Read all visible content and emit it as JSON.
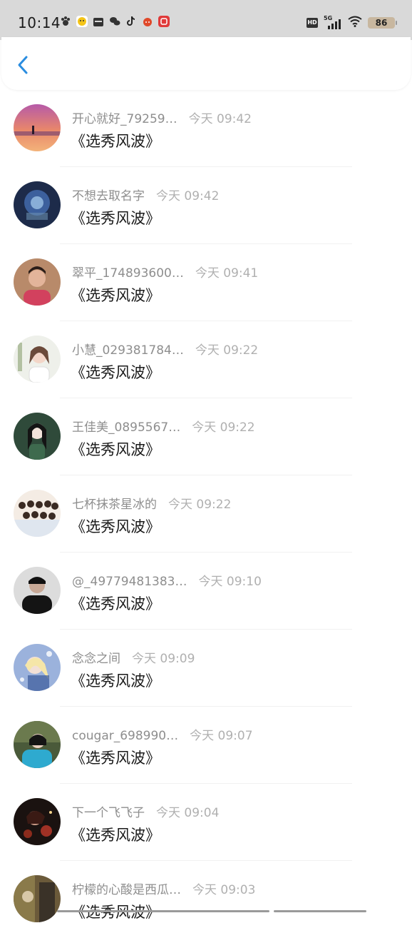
{
  "status_bar": {
    "time": "10:14",
    "network": "5G",
    "hd": "HD",
    "battery": "86"
  },
  "header": {
    "back_icon": "chevron-left-icon",
    "accent_color": "#2a8de0"
  },
  "items": [
    {
      "name": "开心就好_79259…",
      "time": "今天 09:42",
      "message": "《选秀风波》"
    },
    {
      "name": "不想去取名字",
      "time": "今天 09:42",
      "message": "《选秀风波》"
    },
    {
      "name": "翠平_174893600…",
      "time": "今天 09:41",
      "message": "《选秀风波》"
    },
    {
      "name": "小慧_029381784…",
      "time": "今天 09:22",
      "message": "《选秀风波》"
    },
    {
      "name": "王佳美_0895567…",
      "time": "今天 09:22",
      "message": "《选秀风波》"
    },
    {
      "name": "七杯抹茶星冰的",
      "time": "今天 09:22",
      "message": "《选秀风波》"
    },
    {
      "name": "@_49779481383…",
      "time": "今天 09:10",
      "message": "《选秀风波》"
    },
    {
      "name": "念念之间",
      "time": "今天 09:09",
      "message": "《选秀风波》"
    },
    {
      "name": "cougar_698990…",
      "time": "今天 09:07",
      "message": "《选秀风波》"
    },
    {
      "name": "下一个飞飞子",
      "time": "今天 09:04",
      "message": "《选秀风波》"
    },
    {
      "name": "柠檬的心酸是西瓜…",
      "time": "今天 09:03",
      "message": "《选秀风波》"
    }
  ]
}
